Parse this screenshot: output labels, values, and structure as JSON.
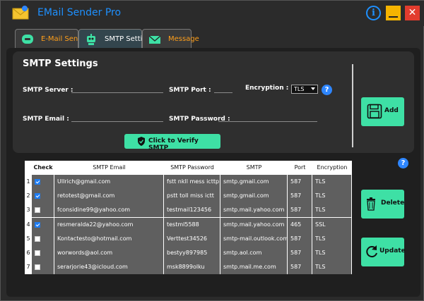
{
  "app": {
    "title": "EMail Sender Pro"
  },
  "window_controls": {
    "info": "i",
    "minimize": "",
    "close": "✕"
  },
  "tabs": [
    {
      "label": "E-Mail Sender",
      "icon": "message-bubble-icon"
    },
    {
      "label": "SMTP Settings",
      "icon": "robot-icon"
    },
    {
      "label": "Message",
      "icon": "mail-envelope-icon"
    }
  ],
  "smtp": {
    "heading": "SMTP Settings",
    "server_label": "SMTP Server :",
    "port_label": "SMTP Port :",
    "encryption_label": "Encryption :",
    "encryption_value": "TLS",
    "email_label": "SMTP Email :",
    "password_label": "SMTP Password :",
    "verify_label": "Click to Verify SMTP",
    "add_label": "Add",
    "help": "?"
  },
  "table": {
    "help": "?",
    "columns": [
      "Check",
      "SMTP Email",
      "SMTP Password",
      "SMTP",
      "Port",
      "Encryption"
    ],
    "rows": [
      {
        "n": "1",
        "checked": true,
        "email": "Ullrich@gmail.com",
        "password": "fstt nkll mess icttp",
        "smtp": "smtp.gmail.com",
        "port": "587",
        "enc": "TLS"
      },
      {
        "n": "2",
        "checked": true,
        "email": "retotest@gmail.com",
        "password": "pstt toll miss ictt",
        "smtp": "smtp.gmail.com",
        "port": "587",
        "enc": "TLS"
      },
      {
        "n": "3",
        "checked": false,
        "email": "fconsidine99@yahoo.com",
        "password": "testmail123456",
        "smtp": "smtp.mail.yahoo.com",
        "port": "587",
        "enc": "TLS"
      },
      {
        "n": "4",
        "checked": true,
        "email": "resmeralda22@yahoo.com",
        "password": "testml5588",
        "smtp": "smtp.mail.yahoo.com",
        "port": "465",
        "enc": "SSL"
      },
      {
        "n": "5",
        "checked": false,
        "email": "Kontactesto@hotmail.com",
        "password": "Verttest34526",
        "smtp": "smtp-mail.outlook.com",
        "port": "587",
        "enc": "TLS"
      },
      {
        "n": "6",
        "checked": false,
        "email": "worwords@aol.com",
        "password": "bestyy897985",
        "smtp": "smtp.aol.com",
        "port": "587",
        "enc": "TLS"
      },
      {
        "n": "7",
        "checked": false,
        "email": "serarjorie43@icloud.com",
        "password": "msk8899olku",
        "smtp": "smtp.mail.me.com",
        "port": "587",
        "enc": "TLS"
      }
    ]
  },
  "actions": {
    "delete_label": "Delete",
    "update_label": "Update"
  },
  "colors": {
    "accent": "#3ee0a5",
    "title": "#1e90ff",
    "minimize": "#f5b400",
    "close": "#e23c2e",
    "checked": "#1e7cf2"
  }
}
